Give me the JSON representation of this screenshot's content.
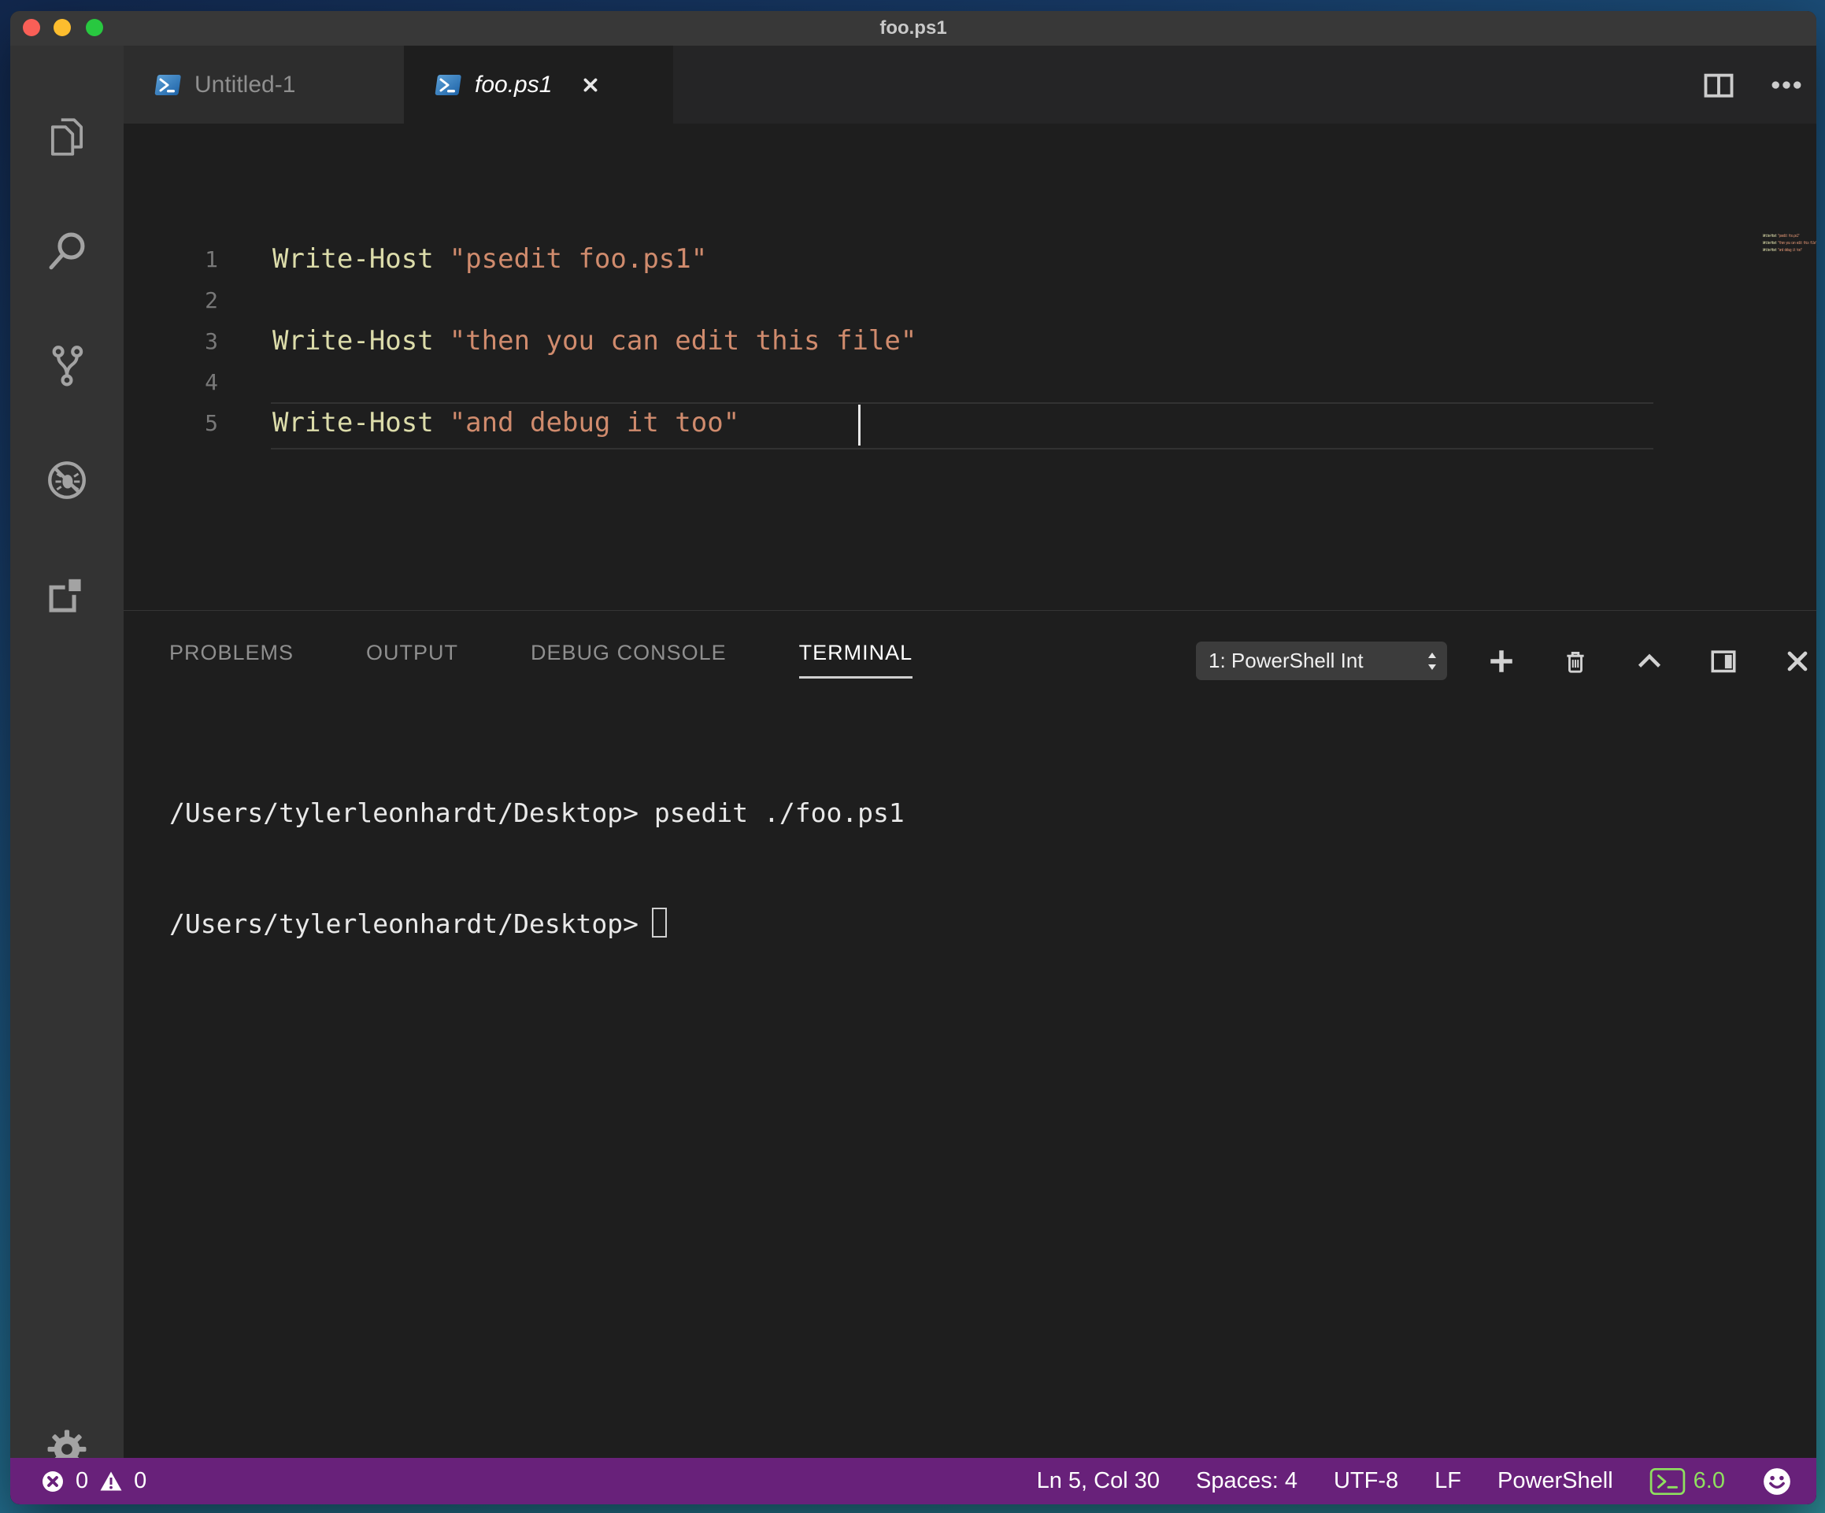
{
  "window": {
    "title": "foo.ps1"
  },
  "activity_bar": {
    "items": [
      {
        "name": "explorer"
      },
      {
        "name": "search"
      },
      {
        "name": "source-control"
      },
      {
        "name": "debug"
      },
      {
        "name": "extensions"
      }
    ],
    "settings": "settings"
  },
  "tabs": [
    {
      "label": "Untitled-1",
      "active": false
    },
    {
      "label": "foo.ps1",
      "active": true
    }
  ],
  "editor": {
    "cursor_position": "Ln 5, Col 30",
    "lines": [
      {
        "num": "1",
        "cmd": "Write-Host",
        "str": "\"psedit foo.ps1\""
      },
      {
        "num": "2",
        "cmd": "",
        "str": ""
      },
      {
        "num": "3",
        "cmd": "Write-Host",
        "str": "\"then you can edit this file\""
      },
      {
        "num": "4",
        "cmd": "",
        "str": ""
      },
      {
        "num": "5",
        "cmd": "Write-Host",
        "str": "\"and debug it too\""
      }
    ]
  },
  "panel": {
    "tabs": [
      {
        "label": "PROBLEMS",
        "active": false
      },
      {
        "label": "OUTPUT",
        "active": false
      },
      {
        "label": "DEBUG CONSOLE",
        "active": false
      },
      {
        "label": "TERMINAL",
        "active": true
      }
    ],
    "terminal_select": "1: PowerShell Int",
    "terminal": {
      "lines": [
        {
          "prompt": "/Users/tylerleonhardt/Desktop>",
          "command": " psedit ./foo.ps1"
        },
        {
          "prompt": "/Users/tylerleonhardt/Desktop>",
          "command": ""
        }
      ]
    }
  },
  "status_bar": {
    "errors": "0",
    "warnings": "0",
    "cursor_position": "Ln 5, Col 30",
    "indentation": "Spaces: 4",
    "encoding": "UTF-8",
    "eol": "LF",
    "language": "PowerShell",
    "powershell_version": "6.0"
  },
  "colors": {
    "status_bar_bg": "#68217A",
    "powershell_green": "#8fe05f",
    "keyword": "#dcdcaa",
    "string": "#d08b6d",
    "editor_bg": "#1e1e1e",
    "tabbar_bg": "#252526",
    "inactive_tab_bg": "#2d2d2d",
    "activity_bar_bg": "#333333",
    "title_bar_bg": "#383838"
  }
}
